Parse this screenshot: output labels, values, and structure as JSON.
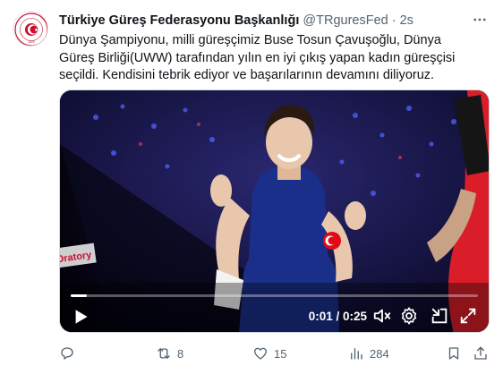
{
  "tweet": {
    "author": "Türkiye Güreş Federasyonu Başkanlığı",
    "handle": "@TRguresFed",
    "separator": "·",
    "time": "2s",
    "text": "Dünya Şampiyonu, milli güreşçimiz Buse Tosun Çavuşoğlu, Dünya Güreş Birliği(UWW) tarafından yılın en iyi çıkış yapan kadın güreşçisi seçildi. Kendisini tebrik ediyor ve başarılarının devamını diliyoruz."
  },
  "avatar": {
    "logo_text": "TÜRKİYE GÜREŞ FEDERASYONU",
    "year": "1923"
  },
  "video": {
    "current_time": "0:01",
    "duration": "0:25",
    "time_display": "0:01 / 0:25",
    "progress": 0.04,
    "banner_text": "Oratory"
  },
  "actions": {
    "replies": "",
    "retweets": "8",
    "likes": "15",
    "views": "284"
  },
  "colors": {
    "text": "#0f1419",
    "muted": "#536471",
    "border": "#cfd9de",
    "singlet": "#1a2f8a",
    "flag_red": "#e30a17"
  },
  "icons": [
    "more-icon",
    "play-icon",
    "mute-icon",
    "settings-icon",
    "minimize-icon",
    "fullscreen-icon",
    "reply-icon",
    "retweet-icon",
    "like-icon",
    "views-icon",
    "bookmark-icon",
    "share-icon"
  ]
}
